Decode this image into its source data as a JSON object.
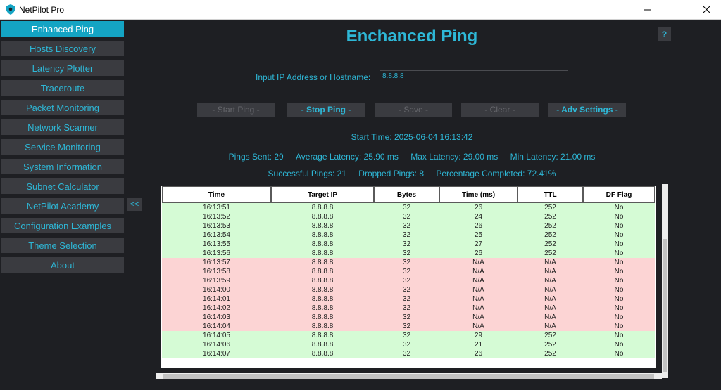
{
  "window": {
    "title": "NetPilot Pro",
    "minimize": "─",
    "maximize": "☐",
    "close": "✕"
  },
  "sidebar": {
    "items": [
      {
        "label": "Enhanced Ping"
      },
      {
        "label": "Hosts Discovery"
      },
      {
        "label": "Latency Plotter"
      },
      {
        "label": "Traceroute"
      },
      {
        "label": "Packet Monitoring"
      },
      {
        "label": "Network Scanner"
      },
      {
        "label": "Service Monitoring"
      },
      {
        "label": "System Information"
      },
      {
        "label": "Subnet Calculator"
      },
      {
        "label": "NetPilot Academy"
      },
      {
        "label": "Configuration Examples"
      },
      {
        "label": "Theme Selection"
      },
      {
        "label": "About"
      }
    ],
    "collapse_label": "<<"
  },
  "main": {
    "title": "Enchanced Ping",
    "help_label": "?",
    "input_label": "Input IP Address or Hostname:",
    "input_value": "8.8.8.8",
    "buttons": {
      "start": "- Start Ping -",
      "stop": "- Stop Ping -",
      "save": "- Save -",
      "clear": "- Clear -",
      "adv": "- Adv Settings -"
    },
    "start_time": "Start Time: 2025-06-04 16:13:42",
    "stats": {
      "pings_sent": "Pings Sent: 29",
      "avg_latency": "Average Latency: 25.90 ms",
      "max_latency": "Max Latency: 29.00 ms",
      "min_latency": "Min Latency: 21.00 ms",
      "successful": "Successful Pings: 21",
      "dropped": "Dropped Pings: 8",
      "percent": "Percentage Completed: 72.41%"
    }
  },
  "table": {
    "headers": [
      "Time",
      "Target IP",
      "Bytes",
      "Time (ms)",
      "TTL",
      "DF Flag"
    ],
    "rows": [
      {
        "status": "ok",
        "cells": [
          "16:13:51",
          "8.8.8.8",
          "32",
          "26",
          "252",
          "No"
        ]
      },
      {
        "status": "ok",
        "cells": [
          "16:13:52",
          "8.8.8.8",
          "32",
          "24",
          "252",
          "No"
        ]
      },
      {
        "status": "ok",
        "cells": [
          "16:13:53",
          "8.8.8.8",
          "32",
          "26",
          "252",
          "No"
        ]
      },
      {
        "status": "ok",
        "cells": [
          "16:13:54",
          "8.8.8.8",
          "32",
          "25",
          "252",
          "No"
        ]
      },
      {
        "status": "ok",
        "cells": [
          "16:13:55",
          "8.8.8.8",
          "32",
          "27",
          "252",
          "No"
        ]
      },
      {
        "status": "ok",
        "cells": [
          "16:13:56",
          "8.8.8.8",
          "32",
          "26",
          "252",
          "No"
        ]
      },
      {
        "status": "fail",
        "cells": [
          "16:13:57",
          "8.8.8.8",
          "32",
          "N/A",
          "N/A",
          "No"
        ]
      },
      {
        "status": "fail",
        "cells": [
          "16:13:58",
          "8.8.8.8",
          "32",
          "N/A",
          "N/A",
          "No"
        ]
      },
      {
        "status": "fail",
        "cells": [
          "16:13:59",
          "8.8.8.8",
          "32",
          "N/A",
          "N/A",
          "No"
        ]
      },
      {
        "status": "fail",
        "cells": [
          "16:14:00",
          "8.8.8.8",
          "32",
          "N/A",
          "N/A",
          "No"
        ]
      },
      {
        "status": "fail",
        "cells": [
          "16:14:01",
          "8.8.8.8",
          "32",
          "N/A",
          "N/A",
          "No"
        ]
      },
      {
        "status": "fail",
        "cells": [
          "16:14:02",
          "8.8.8.8",
          "32",
          "N/A",
          "N/A",
          "No"
        ]
      },
      {
        "status": "fail",
        "cells": [
          "16:14:03",
          "8.8.8.8",
          "32",
          "N/A",
          "N/A",
          "No"
        ]
      },
      {
        "status": "fail",
        "cells": [
          "16:14:04",
          "8.8.8.8",
          "32",
          "N/A",
          "N/A",
          "No"
        ]
      },
      {
        "status": "ok",
        "cells": [
          "16:14:05",
          "8.8.8.8",
          "32",
          "29",
          "252",
          "No"
        ]
      },
      {
        "status": "ok",
        "cells": [
          "16:14:06",
          "8.8.8.8",
          "32",
          "21",
          "252",
          "No"
        ]
      },
      {
        "status": "ok",
        "cells": [
          "16:14:07",
          "8.8.8.8",
          "32",
          "26",
          "252",
          "No"
        ]
      }
    ]
  },
  "colors": {
    "accent": "#2eb7d6",
    "active_bg": "#14a4c4",
    "background": "#1e1f23",
    "button_bg": "#3a3b40",
    "success_row": "#d5fbd5",
    "fail_row": "#fcd4d4"
  }
}
